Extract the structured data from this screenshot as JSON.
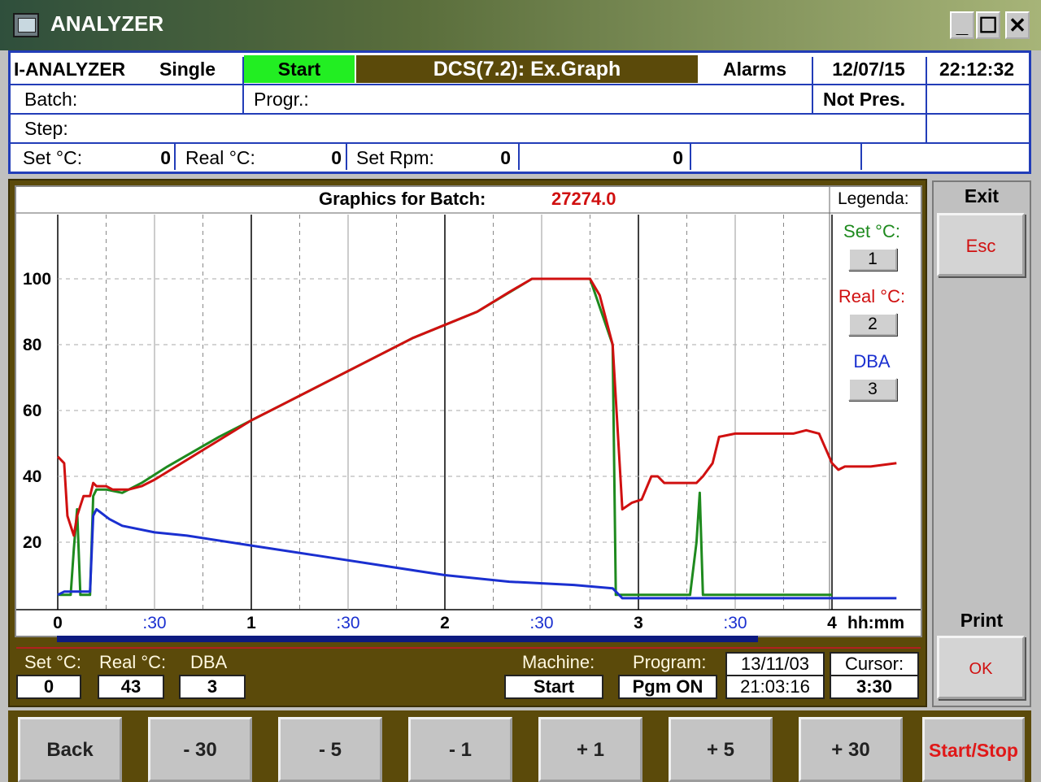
{
  "window": {
    "title": "ANALYZER",
    "min": "_",
    "max": "☐",
    "close": "✕"
  },
  "header": {
    "machine": "I-ANALYZER",
    "mode": "Single",
    "state": "Start",
    "screen": "DCS(7.2): Ex.Graph",
    "alarms": "Alarms",
    "date": "12/07/15",
    "time": "22:12:32",
    "batch_label": "Batch:",
    "progr_label": "Progr.:",
    "not_pres": "Not Pres.",
    "step_label": "Step:",
    "set_c_label": "Set °C:",
    "set_c_value": "0",
    "real_c_label": "Real °C:",
    "real_c_value": "0",
    "set_rpm_label": "Set Rpm:",
    "set_rpm_value": "0",
    "extra_value": "0"
  },
  "chart_header": {
    "title": "Graphics for Batch:",
    "batch": "27274.0",
    "legend_title": "Legenda:"
  },
  "legend": [
    {
      "label": "Set °C:",
      "button": "1",
      "color": "#1e8a1e"
    },
    {
      "label": "Real °C:",
      "button": "2",
      "color": "#d01010"
    },
    {
      "label": "DBA",
      "button": "3",
      "color": "#1a2fd0"
    }
  ],
  "chart_data": {
    "type": "line",
    "xlabel": "hh:mm",
    "x_ticks": [
      "0",
      ":30",
      "1",
      ":30",
      "2",
      ":30",
      "3",
      ":30",
      "4"
    ],
    "y_ticks": [
      "20",
      "40",
      "60",
      "80",
      "100"
    ],
    "xlim": [
      0,
      240
    ],
    "ylim": [
      0,
      120
    ],
    "grid": true,
    "series": [
      {
        "name": "Set °C:",
        "color": "#1e8a1e",
        "points": [
          [
            0,
            4
          ],
          [
            4,
            4
          ],
          [
            5,
            18
          ],
          [
            6,
            30
          ],
          [
            7,
            4
          ],
          [
            10,
            4
          ],
          [
            11,
            34
          ],
          [
            12,
            36
          ],
          [
            15,
            36
          ],
          [
            20,
            35
          ],
          [
            26,
            38
          ],
          [
            34,
            43
          ],
          [
            50,
            52
          ],
          [
            70,
            62
          ],
          [
            90,
            72
          ],
          [
            110,
            82
          ],
          [
            130,
            90
          ],
          [
            147,
            100
          ],
          [
            165,
            100
          ],
          [
            172,
            80
          ],
          [
            173,
            4
          ],
          [
            175,
            4
          ],
          [
            196,
            4
          ],
          [
            198,
            20
          ],
          [
            199,
            35
          ],
          [
            200,
            4
          ],
          [
            210,
            4
          ],
          [
            212,
            4
          ],
          [
            213,
            4
          ],
          [
            214,
            4
          ],
          [
            216,
            4
          ],
          [
            240,
            4
          ]
        ]
      },
      {
        "name": "Real °C:",
        "color": "#d01010",
        "points": [
          [
            0,
            46
          ],
          [
            2,
            44
          ],
          [
            3,
            28
          ],
          [
            5,
            22
          ],
          [
            6,
            28
          ],
          [
            8,
            34
          ],
          [
            10,
            34
          ],
          [
            11,
            38
          ],
          [
            12,
            37
          ],
          [
            15,
            37
          ],
          [
            17,
            36
          ],
          [
            22,
            36
          ],
          [
            26,
            37
          ],
          [
            30,
            39
          ],
          [
            40,
            45
          ],
          [
            50,
            51
          ],
          [
            60,
            57
          ],
          [
            70,
            62
          ],
          [
            80,
            67
          ],
          [
            90,
            72
          ],
          [
            100,
            77
          ],
          [
            110,
            82
          ],
          [
            120,
            86
          ],
          [
            130,
            90
          ],
          [
            140,
            96
          ],
          [
            147,
            100
          ],
          [
            165,
            100
          ],
          [
            168,
            95
          ],
          [
            172,
            80
          ],
          [
            175,
            30
          ],
          [
            178,
            32
          ],
          [
            181,
            33
          ],
          [
            184,
            40
          ],
          [
            186,
            40
          ],
          [
            188,
            38
          ],
          [
            192,
            38
          ],
          [
            198,
            38
          ],
          [
            200,
            40
          ],
          [
            203,
            44
          ],
          [
            205,
            52
          ],
          [
            210,
            53
          ],
          [
            220,
            53
          ],
          [
            228,
            53
          ],
          [
            232,
            54
          ],
          [
            236,
            53
          ],
          [
            240,
            44
          ],
          [
            242,
            42
          ],
          [
            244,
            43
          ],
          [
            252,
            43
          ],
          [
            260,
            44
          ]
        ]
      },
      {
        "name": "DBA",
        "color": "#1a2fd0",
        "points": [
          [
            0,
            4
          ],
          [
            2,
            5
          ],
          [
            10,
            5
          ],
          [
            11,
            28
          ],
          [
            12,
            30
          ],
          [
            16,
            27
          ],
          [
            20,
            25
          ],
          [
            30,
            23
          ],
          [
            40,
            22
          ],
          [
            60,
            19
          ],
          [
            80,
            16
          ],
          [
            100,
            13
          ],
          [
            120,
            10
          ],
          [
            140,
            8
          ],
          [
            160,
            7
          ],
          [
            172,
            6
          ],
          [
            175,
            3
          ],
          [
            180,
            3
          ],
          [
            190,
            3
          ],
          [
            200,
            3
          ],
          [
            220,
            3
          ],
          [
            240,
            3
          ],
          [
            260,
            3
          ]
        ]
      }
    ]
  },
  "status": {
    "set_c_label": "Set °C:",
    "set_c_value": "0",
    "real_c_label": "Real °C:",
    "real_c_value": "43",
    "dba_label": "DBA",
    "dba_value": "3",
    "machine_label": "Machine:",
    "machine_value": "Start",
    "program_label": "Program:",
    "program_value": "Pgm ON",
    "stamp_date": "13/11/03",
    "stamp_time": "21:03:16",
    "cursor_label": "Cursor:",
    "cursor_value": "3:30"
  },
  "right": {
    "exit_label": "Exit",
    "esc_button": "Esc",
    "print_label": "Print",
    "ok_button": "OK"
  },
  "buttons": {
    "back": "Back",
    "minus30": "- 30",
    "minus5": "- 5",
    "minus1": "- 1",
    "plus1": "+ 1",
    "plus5": "+ 5",
    "plus30": "+ 30",
    "startstop": "Start/Stop"
  }
}
